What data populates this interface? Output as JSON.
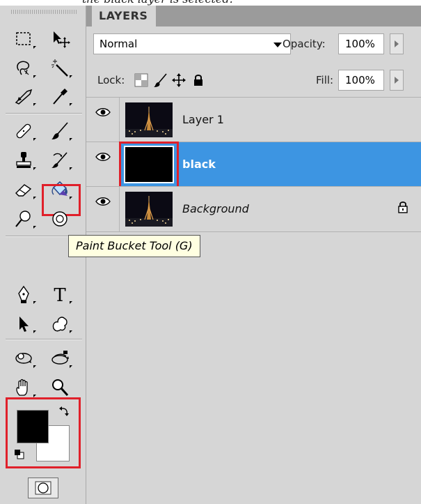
{
  "caption": {
    "text": "the black layer is selected."
  },
  "panel": {
    "tab_label": "LAYERS"
  },
  "blend": {
    "mode": "Normal",
    "opacity_label": "Opacity:",
    "opacity_value": "100%"
  },
  "lock": {
    "label": "Lock:",
    "fill_label": "Fill:",
    "fill_value": "100%"
  },
  "layers": [
    {
      "name": "Layer 1",
      "visible": true,
      "selected": false,
      "thumbnail": "eiffel-tower-night"
    },
    {
      "name": "black",
      "visible": true,
      "selected": true,
      "thumbnail": "solid-black"
    },
    {
      "name": "Background",
      "visible": true,
      "selected": false,
      "locked": true,
      "thumbnail": "eiffel-tower-night"
    }
  ],
  "tooltip": {
    "text": "Paint Bucket Tool (G)"
  },
  "toolbox": {
    "tools": [
      "marquee-icon",
      "move-icon",
      "lasso-icon",
      "magic-wand-icon",
      "crop-icon",
      "eyedropper-icon",
      "healing-brush-icon",
      "brush-icon",
      "clone-stamp-icon",
      "history-brush-icon",
      "eraser-icon",
      "paint-bucket-icon",
      "dodge-icon",
      "blur-icon",
      "pen-icon",
      "type-icon",
      "path-selection-icon",
      "custom-shape-icon",
      "3d-rotate-icon",
      "3d-orbit-icon",
      "hand-icon",
      "zoom-icon"
    ],
    "active_tool": "paint-bucket-icon",
    "foreground_color": "#000000",
    "background_color": "#ffffff"
  },
  "colors": {
    "selection_blue": "#3d95e2",
    "highlight_red": "#e0202a"
  }
}
